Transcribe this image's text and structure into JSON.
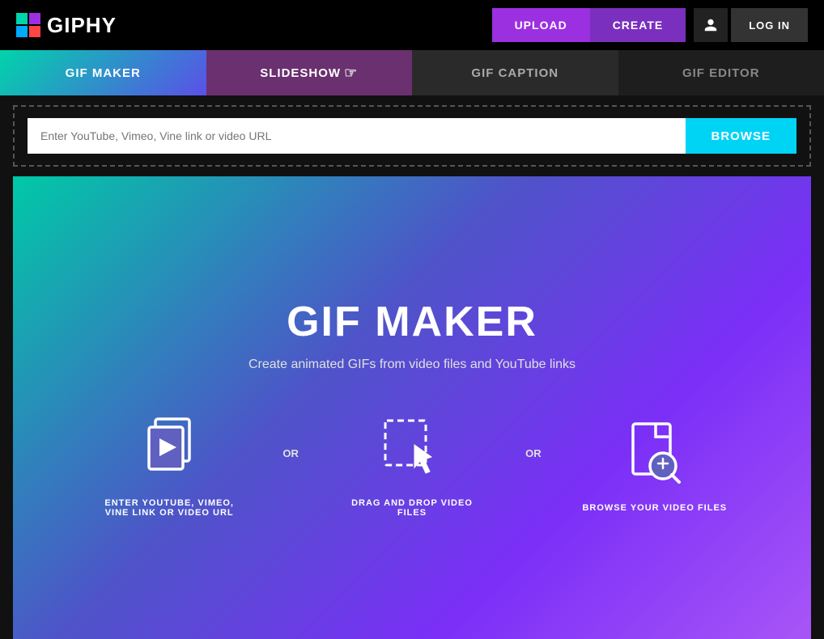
{
  "header": {
    "logo_text": "GIPHY",
    "upload_label": "UPLOAD",
    "create_label": "CREATE",
    "login_label": "LOG IN"
  },
  "tabs": [
    {
      "id": "gif-maker",
      "label": "GIF MAKER",
      "active": true
    },
    {
      "id": "slideshow",
      "label": "SLIDESHOW",
      "active": false
    },
    {
      "id": "gif-caption",
      "label": "GIF CAPTION",
      "active": false
    },
    {
      "id": "gif-editor",
      "label": "GIF EDITOR",
      "active": false
    }
  ],
  "upload": {
    "input_placeholder": "Enter YouTube, Vimeo, Vine link or video URL",
    "browse_label": "BROWSE"
  },
  "main": {
    "title": "GIF MAKER",
    "subtitle": "Create animated GIFs from video files and YouTube links",
    "icons": [
      {
        "id": "enter-url",
        "label": "ENTER YOUTUBE, VIMEO,\nVINE LINK OR VIDEO URL"
      },
      {
        "id": "drag-drop",
        "label": "DRAG AND DROP VIDEO\nFILES"
      },
      {
        "id": "browse-files",
        "label": "BROWSE YOUR VIDEO FILES"
      }
    ],
    "or_label": "OR"
  }
}
